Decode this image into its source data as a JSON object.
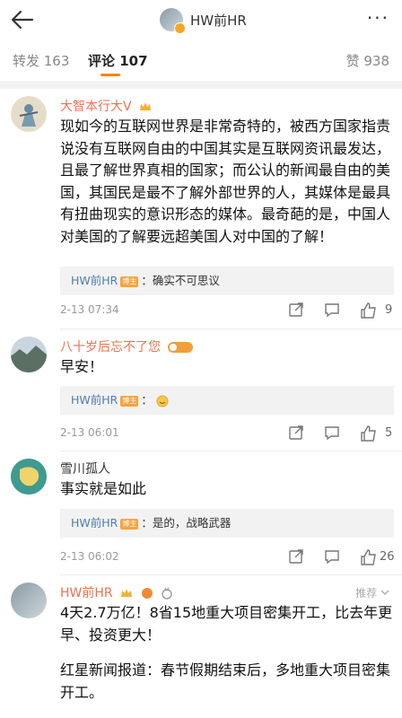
{
  "header": {
    "title": "HW前HR",
    "back_icon": "back-arrow-icon",
    "more_icon": "more-dots-icon"
  },
  "tabs": [
    {
      "label": "转发 163"
    },
    {
      "label": "评论 107"
    },
    {
      "label": "赞 938"
    }
  ],
  "comments": [
    {
      "user": "大智本行大V",
      "text": "现如今的互联网世界是非常奇特的，被西方国家指责说没有互联网自由的中国其实是互联网资讯最发达，且最了解世界真相的国家；而公认的新闻最自由的美国，其国民是最不了解外部世界的人，其媒体是最具有扭曲现实的意识形态的媒体。最奇葩的是，中国人对美国的了解要远超美国人对中国的了解！",
      "reply": {
        "name": "HW前HR",
        "badge": "博主",
        "text": "：确实不可思议"
      },
      "time": "2-13 07:34",
      "likes": "9"
    },
    {
      "user": "八十岁后忘不了您",
      "text": "早安！",
      "reply": {
        "name": "HW前HR",
        "badge": "博主",
        "text": "："
      },
      "time": "2-13 06:01",
      "likes": "5"
    },
    {
      "user": "雪川孤人",
      "text": "事实就是如此",
      "reply": {
        "name": "HW前HR",
        "badge": "博主",
        "text": "：是的，战略武器"
      },
      "time": "2-13 06:02",
      "likes": "26"
    },
    {
      "user": "HW前HR",
      "recommend": "推荐",
      "text1": "4天2.7万亿！8省15地重大项目密集开工，比去年更早、投资更大！",
      "text2": "红星新闻报道：春节假期结束后，多地重大项目密集开工。"
    }
  ],
  "colors": {
    "accent": "#ff8200",
    "username": "#eb7350",
    "link": "#507daf"
  }
}
